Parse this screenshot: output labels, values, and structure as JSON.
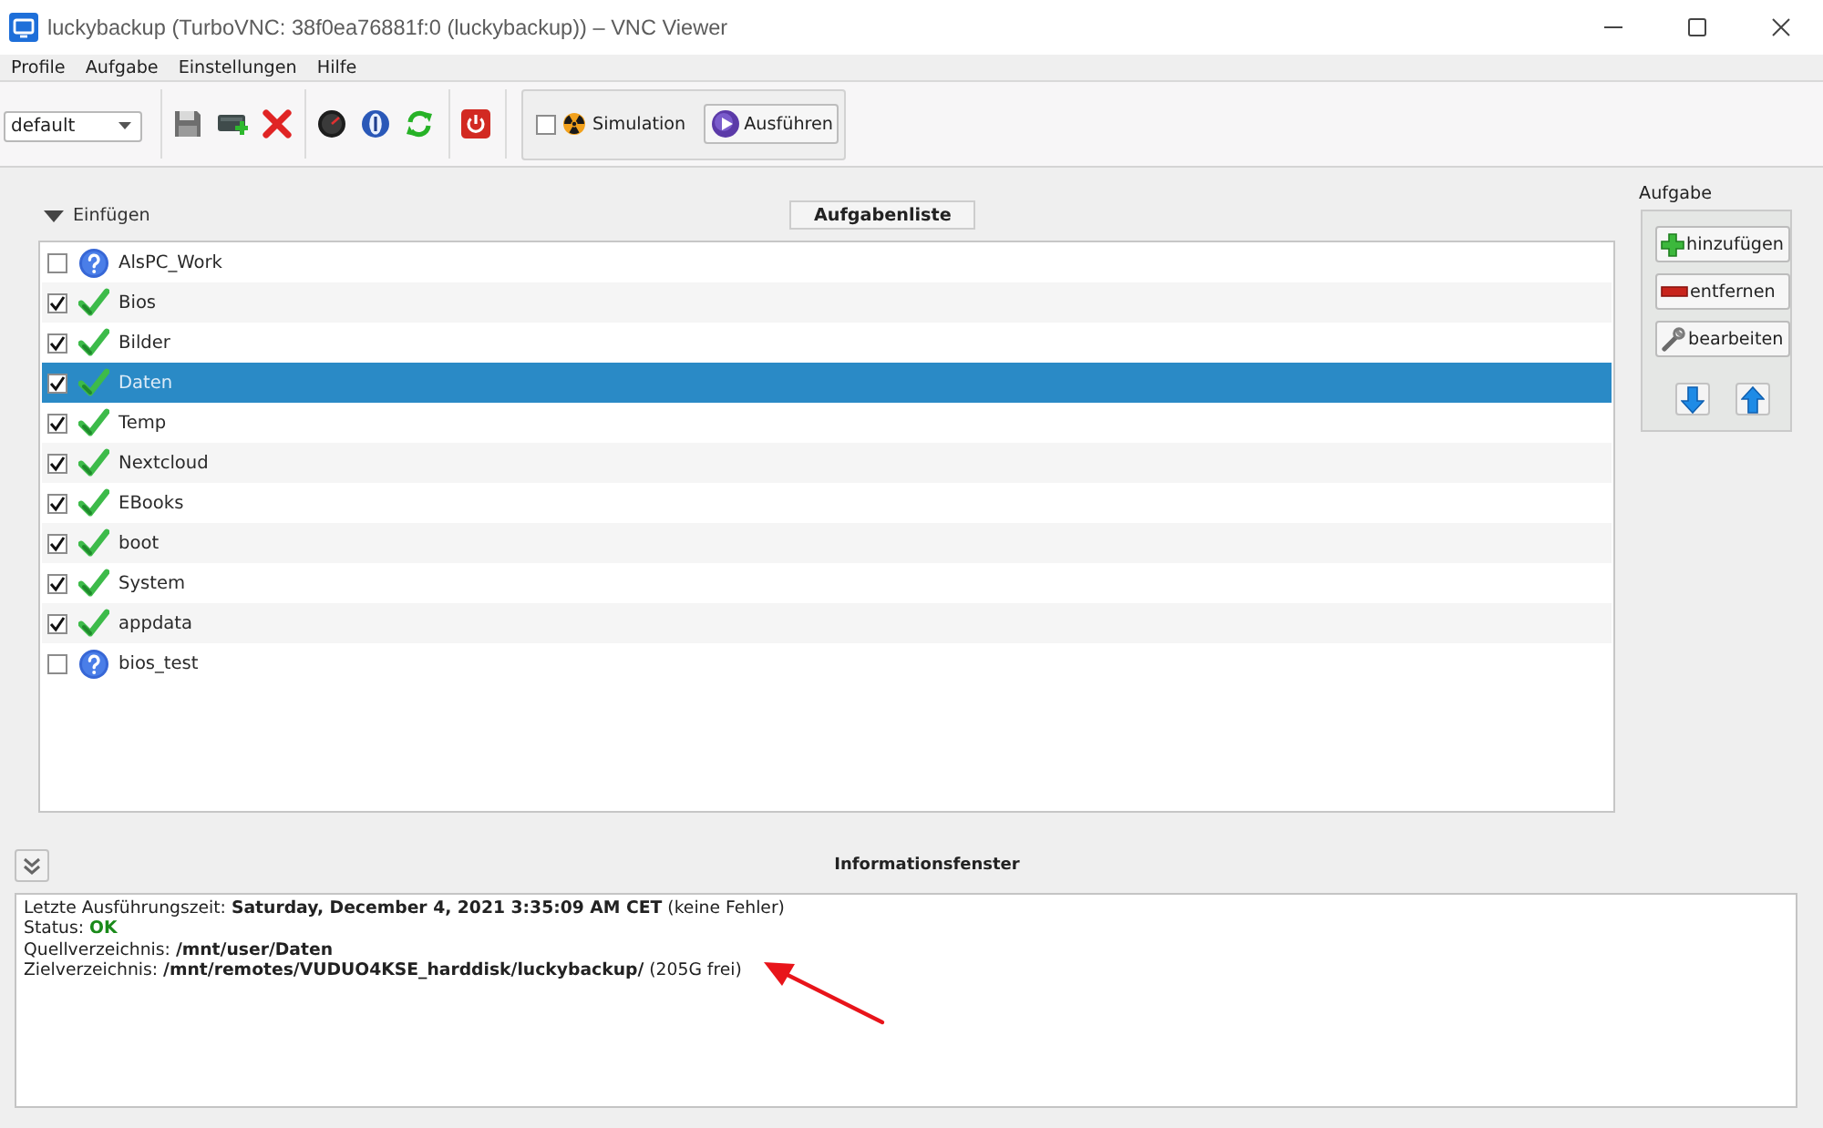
{
  "window": {
    "title": "luckybackup (TurboVNC: 38f0ea76881f:0 (luckybackup)) – VNC Viewer"
  },
  "menu": [
    "Profile",
    "Aufgabe",
    "Einstellungen",
    "Hilfe"
  ],
  "toolbar": {
    "profile": "default",
    "simulation": {
      "label": "Simulation",
      "checked": false
    },
    "run_button": "Ausführen"
  },
  "task_list": {
    "insert_toggle": {
      "label": "Einfügen",
      "expanded": true
    },
    "header": "Aufgabenliste",
    "items": [
      {
        "name": "AlsPC_Work",
        "checked": false,
        "kind": "unknown",
        "selected": false
      },
      {
        "name": "Bios",
        "checked": true,
        "kind": "ok",
        "selected": false
      },
      {
        "name": "Bilder",
        "checked": true,
        "kind": "ok",
        "selected": false
      },
      {
        "name": "Daten",
        "checked": true,
        "kind": "ok",
        "selected": true
      },
      {
        "name": "Temp",
        "checked": true,
        "kind": "ok",
        "selected": false
      },
      {
        "name": "Nextcloud",
        "checked": true,
        "kind": "ok",
        "selected": false
      },
      {
        "name": "EBooks",
        "checked": true,
        "kind": "ok",
        "selected": false
      },
      {
        "name": "boot",
        "checked": true,
        "kind": "ok",
        "selected": false
      },
      {
        "name": "System",
        "checked": true,
        "kind": "ok",
        "selected": false
      },
      {
        "name": "appdata",
        "checked": true,
        "kind": "ok",
        "selected": false
      },
      {
        "name": "bios_test",
        "checked": false,
        "kind": "unknown",
        "selected": false
      }
    ]
  },
  "task_panel": {
    "title": "Aufgabe",
    "buttons": [
      {
        "kind": "add",
        "label": "hinzufügen"
      },
      {
        "kind": "remove",
        "label": "entfernen"
      },
      {
        "kind": "edit",
        "label": "bearbeiten"
      }
    ]
  },
  "info_panel": {
    "title": "Informationsfenster",
    "lines": [
      {
        "kind": "plain",
        "label": "Letzte Ausführungszeit:",
        "value": "Saturday, December 4, 2021 3:35:09 AM CET",
        "note": "(keine Fehler)"
      },
      {
        "kind": "status",
        "label": "Status:",
        "value": "OK"
      },
      {
        "kind": "plain",
        "label": "Quellverzeichnis:",
        "value": "/mnt/user/Daten"
      },
      {
        "kind": "plain",
        "label": "Zielverzeichnis:",
        "value": "/mnt/remotes/VUDUO4KSE_harddisk/luckybackup/",
        "note": "(205G frei)"
      }
    ]
  }
}
